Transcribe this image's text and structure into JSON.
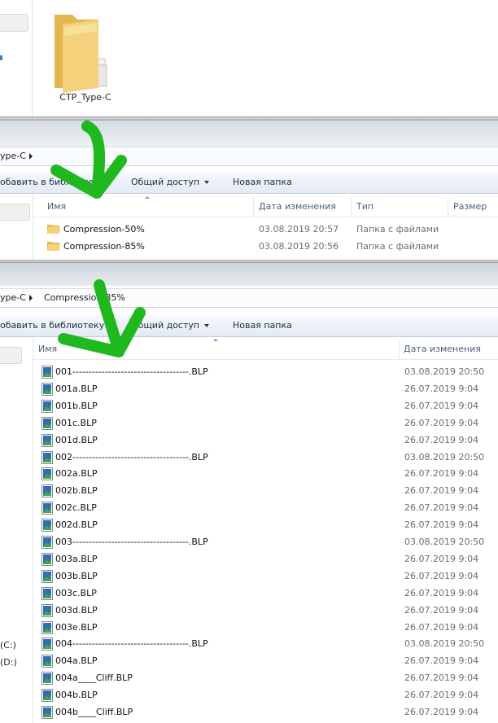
{
  "panel1": {
    "folder_label": "CTP_Type-C"
  },
  "panel2": {
    "breadcrumb": [
      "ype-C"
    ],
    "toolbar": {
      "add_to_library": "обавить в библиотеку",
      "share": "Общий доступ",
      "new_folder": "Новая папка"
    },
    "columns": {
      "name": "Имя",
      "date": "Дата изменения",
      "type": "Тип",
      "size": "Размер"
    },
    "rows": [
      {
        "name": "Compression-50%",
        "date": "03.08.2019 20:57",
        "type": "Папка с файлами"
      },
      {
        "name": "Compression-85%",
        "date": "03.08.2019 20:56",
        "type": "Папка с файлами"
      }
    ]
  },
  "panel3": {
    "breadcrumb": [
      "ype-C",
      "Compression-85%"
    ],
    "toolbar": {
      "add_to_library": "обавить в библиотеку",
      "share": "Общий доступ",
      "new_folder": "Новая папка"
    },
    "columns": {
      "name": "Имя",
      "date": "Дата изменения"
    },
    "drives": [
      "(C:)",
      "(D:)"
    ],
    "files": [
      {
        "name": "001------------------------------------.BLP",
        "date": "03.08.2019 20:50"
      },
      {
        "name": "001a.BLP",
        "date": "26.07.2019 9:04"
      },
      {
        "name": "001b.BLP",
        "date": "26.07.2019 9:04"
      },
      {
        "name": "001c.BLP",
        "date": "26.07.2019 9:04"
      },
      {
        "name": "001d.BLP",
        "date": "26.07.2019 9:04"
      },
      {
        "name": "002------------------------------------.BLP",
        "date": "03.08.2019 20:50"
      },
      {
        "name": "002a.BLP",
        "date": "26.07.2019 9:04"
      },
      {
        "name": "002b.BLP",
        "date": "26.07.2019 9:04"
      },
      {
        "name": "002c.BLP",
        "date": "26.07.2019 9:04"
      },
      {
        "name": "002d.BLP",
        "date": "26.07.2019 9:04"
      },
      {
        "name": "003------------------------------------.BLP",
        "date": "03.08.2019 20:50"
      },
      {
        "name": "003a.BLP",
        "date": "26.07.2019 9:04"
      },
      {
        "name": "003b.BLP",
        "date": "26.07.2019 9:04"
      },
      {
        "name": "003c.BLP",
        "date": "26.07.2019 9:04"
      },
      {
        "name": "003d.BLP",
        "date": "26.07.2019 9:04"
      },
      {
        "name": "003e.BLP",
        "date": "26.07.2019 9:04"
      },
      {
        "name": "004------------------------------------.BLP",
        "date": "03.08.2019 20:50"
      },
      {
        "name": "004a.BLP",
        "date": "26.07.2019 9:04"
      },
      {
        "name": "004a____Cliff.BLP",
        "date": "26.07.2019 9:04"
      },
      {
        "name": "004b.BLP",
        "date": "26.07.2019 9:04"
      },
      {
        "name": "004b____Cliff.BLP",
        "date": "26.07.2019 9:04"
      }
    ]
  },
  "colors": {
    "arrow": "#1fb81f",
    "header_text": "#4c607a",
    "date_text": "#6d6d6d"
  }
}
